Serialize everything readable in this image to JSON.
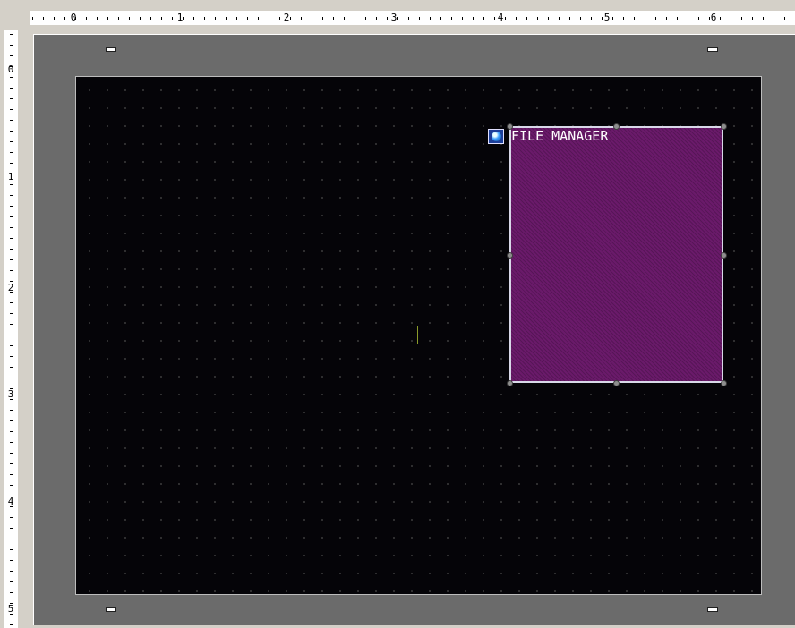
{
  "ruler": {
    "top_labels": [
      "0",
      "1",
      "2",
      "3",
      "4",
      "5",
      "6"
    ],
    "left_labels": [
      "0",
      "1",
      "2",
      "3",
      "4",
      "5"
    ]
  },
  "part": {
    "title": "FILE MANAGER",
    "icon": "globe-icon",
    "fill_color": "#6a1a6a",
    "border_color": "#d8d8e8"
  },
  "screen": {
    "background_color": "#050408",
    "grid_dots": true
  }
}
